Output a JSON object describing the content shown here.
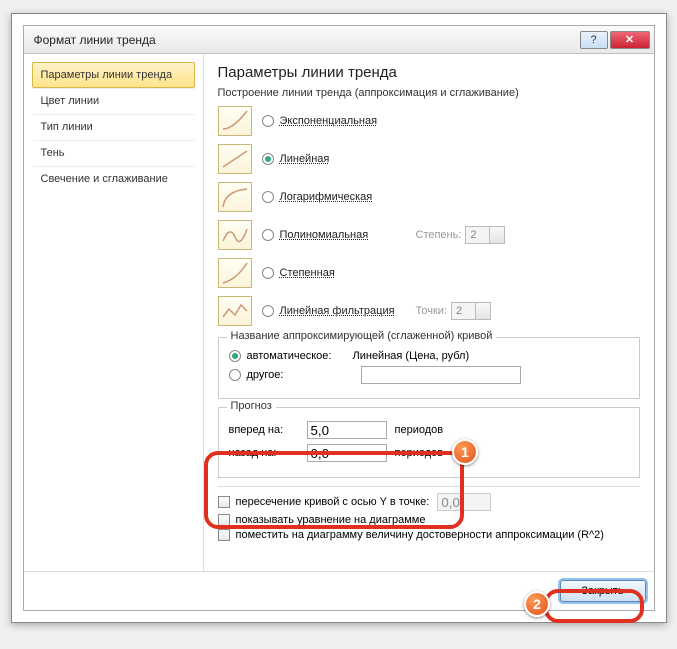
{
  "window": {
    "title": "Формат линии тренда"
  },
  "sidebar": {
    "items": [
      {
        "label": "Параметры линии тренда"
      },
      {
        "label": "Цвет линии"
      },
      {
        "label": "Тип линии"
      },
      {
        "label": "Тень"
      },
      {
        "label": "Свечение и сглаживание"
      }
    ]
  },
  "main": {
    "heading": "Параметры линии тренда",
    "build_label": "Построение линии тренда (аппроксимация и сглаживание)",
    "types": [
      {
        "label": "Экспоненциальная"
      },
      {
        "label": "Линейная"
      },
      {
        "label": "Логарифмическая"
      },
      {
        "label": "Полиномиальная",
        "extra_label": "Степень:",
        "extra_value": "2"
      },
      {
        "label": "Степенная"
      },
      {
        "label": "Линейная фильтрация",
        "extra_label": "Точки:",
        "extra_value": "2"
      }
    ],
    "name_group": {
      "legend": "Название аппроксимирующей (сглаженной) кривой",
      "auto_label": "автоматическое:",
      "auto_value": "Линейная (Цена, рубл)",
      "other_label": "другое:",
      "other_value": ""
    },
    "forecast": {
      "legend": "Прогноз",
      "forward_label": "вперед на:",
      "forward_value": "5,0",
      "backward_label": "назад на:",
      "backward_value": "0,0",
      "unit": "периодов"
    },
    "checks": {
      "intercept_label": "пересечение кривой с осью Y в точке:",
      "intercept_value": "0,0",
      "equation_label": "показывать уравнение на диаграмме",
      "r2_label": "поместить на диаграмму величину достоверности аппроксимации (R^2)"
    }
  },
  "footer": {
    "close": "Закрыть"
  },
  "callouts": {
    "one": "1",
    "two": "2"
  }
}
